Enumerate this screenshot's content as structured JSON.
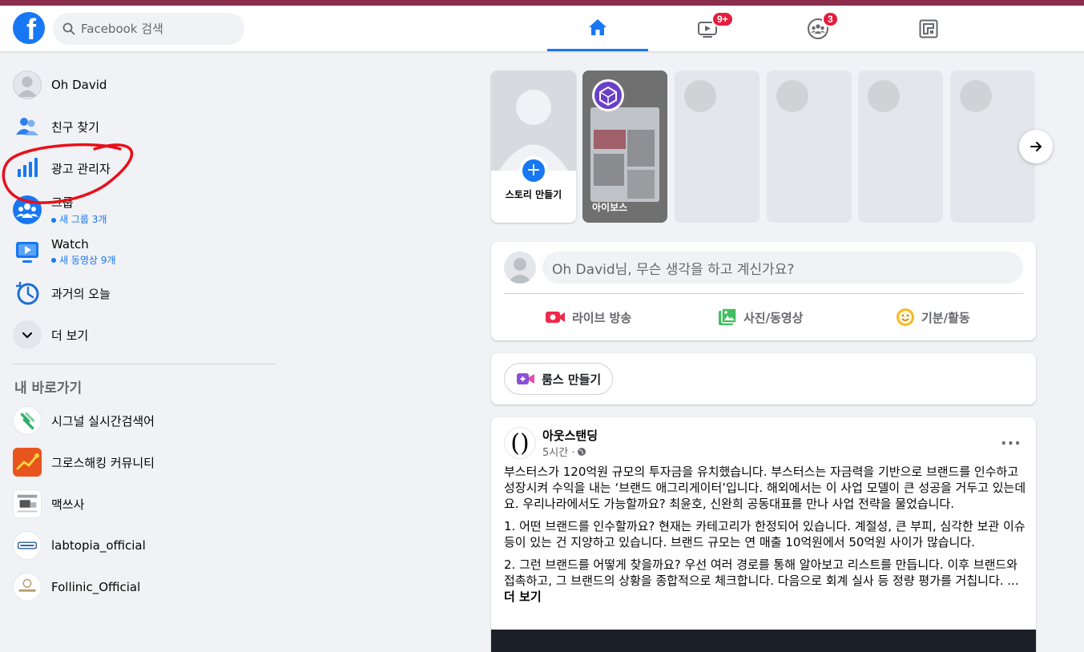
{
  "colors": {
    "brand": "#1877f2",
    "badge": "#e41e3f",
    "window_strip": "#8a2e4c"
  },
  "header": {
    "logo_letter": "f",
    "search_placeholder": "Facebook 검색",
    "tabs": [
      {
        "name": "home",
        "icon": "home-icon",
        "active": true
      },
      {
        "name": "watch",
        "icon": "video-icon",
        "badge": "9+"
      },
      {
        "name": "groups",
        "icon": "groups-icon",
        "badge": "3"
      },
      {
        "name": "gaming",
        "icon": "gaming-icon"
      }
    ]
  },
  "sidebar": {
    "items": [
      {
        "label": "Oh David",
        "icon": "profile-avatar-icon"
      },
      {
        "label": "친구 찾기",
        "icon": "friends-icon"
      },
      {
        "label": "광고 관리자",
        "icon": "ads-manager-icon"
      },
      {
        "label": "그룹",
        "sub": "새 그룹 3개",
        "icon": "groups-icon"
      },
      {
        "label": "Watch",
        "sub": "새 동영상 9개",
        "icon": "watch-icon"
      },
      {
        "label": "과거의 오늘",
        "icon": "memories-icon"
      },
      {
        "label": "더 보기",
        "icon": "chevron-down-icon"
      }
    ],
    "shortcuts_title": "내 바로가기",
    "shortcuts": [
      {
        "label": "시그널 실시간검색어",
        "icon": "signal-logo-icon"
      },
      {
        "label": "그로스해킹 커뮤니티",
        "icon": "growth-hacking-logo-icon"
      },
      {
        "label": "맥쓰사",
        "icon": "macssa-logo-icon"
      },
      {
        "label": "labtopia_official",
        "icon": "labtopia-logo-icon"
      },
      {
        "label": "Follinic_Official",
        "icon": "follinic-logo-icon"
      }
    ]
  },
  "stories": {
    "create_label": "스토리 만들기",
    "items": [
      {
        "name": "아이보스"
      }
    ]
  },
  "composer": {
    "prompt": "Oh David님, 무슨 생각을 하고 계신가요?",
    "actions": [
      {
        "label": "라이브 방송",
        "icon": "live-video-icon",
        "color": "#f02849"
      },
      {
        "label": "사진/동영상",
        "icon": "photo-icon",
        "color": "#45bd62"
      },
      {
        "label": "기분/활동",
        "icon": "feeling-icon",
        "color": "#f7b928"
      }
    ]
  },
  "rooms": {
    "label": "룸스 만들기",
    "icon": "rooms-icon",
    "color": "#8c4fd6"
  },
  "post": {
    "author": "아웃스탠딩",
    "time": "5시간 ·",
    "paragraphs": [
      "부스터스가 120억원 규모의 투자금을 유치했습니다. 부스터스는 자금력을 기반으로 브랜드를 인수하고 성장시켜 수익을 내는 ‘브랜드 애그리게이터’입니다. 해외에서는 이 사업 모델이 큰 성공을 거두고 있는데요. 우리나라에서도 가능할까요? 최윤호, 신완희 공동대표를 만나 사업 전략을 물었습니다.",
      "1. 어떤 브랜드를 인수할까요? 현재는 카테고리가 한정되어 있습니다. 계절성, 큰 부피, 심각한 보관 이슈 등이 있는 건 지양하고 있습니다. 브랜드 규모는 연 매출 10억원에서 50억원 사이가 많습니다.",
      "2. 그런 브랜드를 어떻게 찾을까요? 우선 여러 경로를 통해 알아보고 리스트를 만듭니다. 이후 브랜드와 접촉하고, 그 브랜드의 상황을 종합적으로 체크합니다. 다음으로 회계 실사 등 정량 평가를 거칩니다. ..."
    ],
    "see_more": "더 보기"
  }
}
